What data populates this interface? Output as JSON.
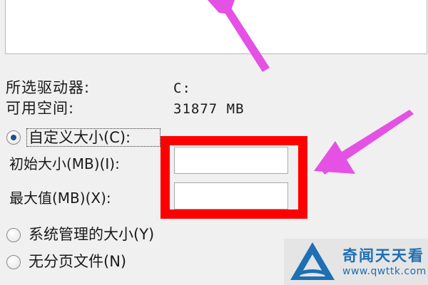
{
  "drive_info": {
    "selected_drive_label": "所选驱动器:",
    "selected_drive_value": "C:",
    "available_space_label": "可用空间:",
    "available_space_value": "31877 MB"
  },
  "paging_options": {
    "custom_size_label": "自定义大小(C):",
    "initial_size_label": "初始大小(MB)(I):",
    "initial_size_value": "",
    "max_size_label": "最大值(MB)(X):",
    "max_size_value": "",
    "system_managed_label": "系统管理的大小(Y)",
    "no_paging_file_label": "无分页文件(N)",
    "selected_option": "custom_size"
  },
  "annotations": {
    "arrow_color": "#e451e4",
    "highlight_color": "#ff0000"
  },
  "watermark": {
    "name": "奇闻天天看",
    "url": "www.qwttk.com",
    "brand_color": "#1e6fb3"
  }
}
